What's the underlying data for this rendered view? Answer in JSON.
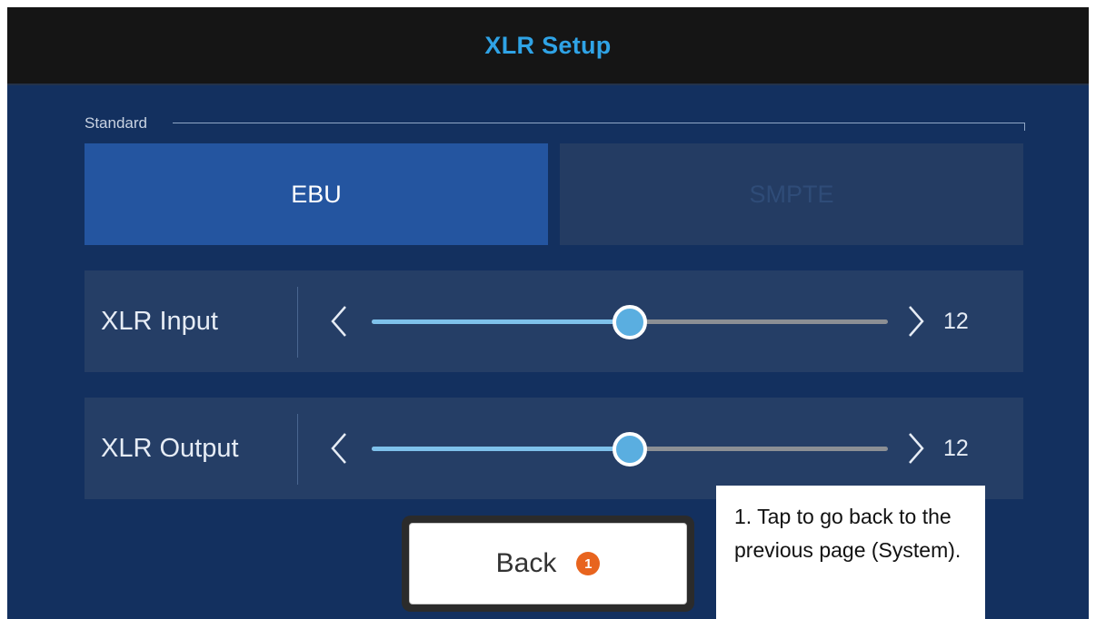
{
  "header": {
    "title": "XLR Setup"
  },
  "standard": {
    "label": "Standard",
    "options": [
      "EBU",
      "SMPTE"
    ],
    "selected": "EBU"
  },
  "sliders": [
    {
      "label": "XLR Input",
      "value": "12",
      "fraction": 0.5,
      "left_icon": "chevron-left-icon",
      "right_icon": "chevron-right-icon"
    },
    {
      "label": "XLR Output",
      "value": "12",
      "fraction": 0.5,
      "left_icon": "chevron-left-icon",
      "right_icon": "chevron-right-icon"
    }
  ],
  "back": {
    "label": "Back",
    "badge": "1"
  },
  "callout": {
    "text": "1. Tap to go back to the previous page (System)."
  },
  "colors": {
    "background": "#13305f",
    "title": "#2fa3e6",
    "selected_segment": "#2455a0",
    "unselected_segment": "#243c63",
    "track_fill": "#7ec1eb",
    "badge": "#e8641e"
  }
}
